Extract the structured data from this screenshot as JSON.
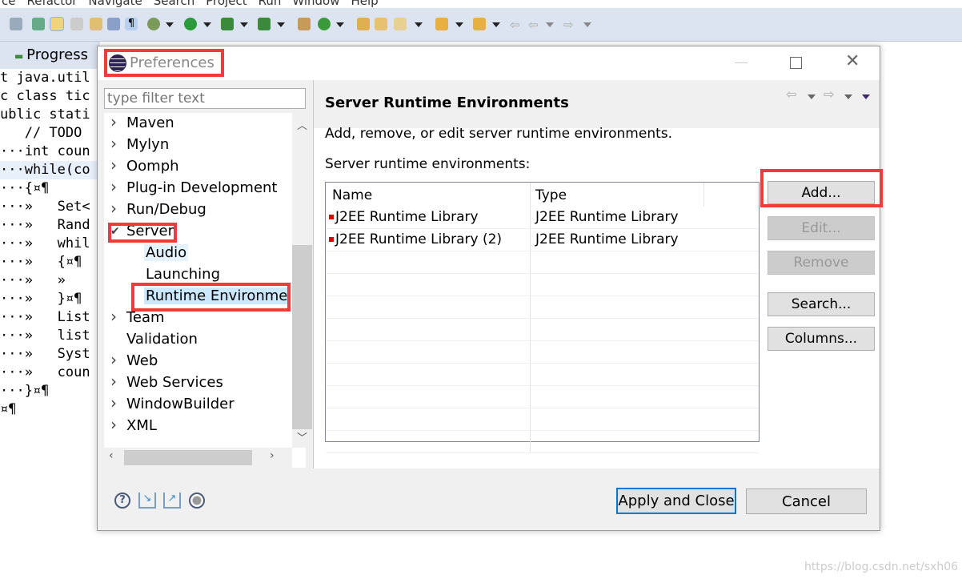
{
  "menubar": [
    "ce",
    "Refactor",
    "Navigate",
    "Search",
    "Project",
    "Run",
    "Window",
    "Help"
  ],
  "editor": {
    "tab": "Progress",
    "lines": [
      "t java.util",
      "",
      "c class tic",
      "",
      "ublic stati",
      "   // TODO ",
      "···int coun",
      "···while(co",
      "···{¤¶",
      "···»   Set<",
      "···»   Rand",
      "···»   whil",
      "···»   {¤¶",
      "···»   »",
      "···»   }¤¶",
      "···»   List",
      "···»   list",
      "···»   Syst",
      "···»   coun",
      "···}¤¶",
      "¤¶"
    ]
  },
  "dialog": {
    "title": "Preferences",
    "filter_placeholder": "type filter text",
    "tree": [
      {
        "label": "Maven",
        "expandable": true
      },
      {
        "label": "Mylyn",
        "expandable": true
      },
      {
        "label": "Oomph",
        "expandable": true
      },
      {
        "label": "Plug-in Development",
        "expandable": true
      },
      {
        "label": "Run/Debug",
        "expandable": true
      },
      {
        "label": "Server",
        "expanded": true
      },
      {
        "label": "Audio",
        "child": true
      },
      {
        "label": "Launching",
        "child": true
      },
      {
        "label": "Runtime Environments",
        "child": true,
        "selected": true
      },
      {
        "label": "Team",
        "expandable": true
      },
      {
        "label": "Validation",
        "expandable": false
      },
      {
        "label": "Web",
        "expandable": true
      },
      {
        "label": "Web Services",
        "expandable": true
      },
      {
        "label": "WindowBuilder",
        "expandable": true
      },
      {
        "label": "XML",
        "expandable": true
      }
    ],
    "page": {
      "title": "Server Runtime Environments",
      "description": "Add, remove, or edit server runtime environments.",
      "list_label": "Server runtime environments:",
      "columns": [
        "Name",
        "Type"
      ],
      "rows": [
        {
          "name": "J2EE Runtime Library",
          "type": "J2EE Runtime Library"
        },
        {
          "name": "J2EE Runtime Library (2)",
          "type": "J2EE Runtime Library"
        }
      ],
      "buttons": {
        "add": "Add...",
        "edit": "Edit...",
        "remove": "Remove",
        "search": "Search...",
        "columns": "Columns..."
      }
    },
    "footer": {
      "apply_close": "Apply and Close",
      "cancel": "Cancel"
    }
  },
  "watermark": "https://blog.csdn.net/sxh06",
  "colors": {
    "highlight": "#f23a3a",
    "error_marker": "#e00000",
    "selection": "#cce8ff"
  }
}
